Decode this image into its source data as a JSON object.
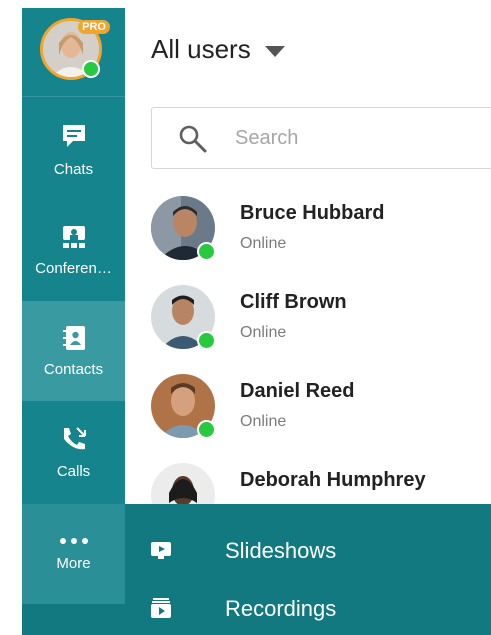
{
  "user": {
    "pro_badge": "PRO"
  },
  "sidebar": {
    "items": [
      {
        "label": "Chats",
        "icon": "chat-icon"
      },
      {
        "label": "Conferen…",
        "icon": "conference-icon"
      },
      {
        "label": "Contacts",
        "icon": "contacts-icon",
        "active": true
      },
      {
        "label": "Calls",
        "icon": "calls-icon"
      }
    ],
    "more_label": "More"
  },
  "header": {
    "title": "All users"
  },
  "search": {
    "placeholder": "Search"
  },
  "contacts": [
    {
      "name": "Bruce Hubbard",
      "status": "Online"
    },
    {
      "name": "Cliff Brown",
      "status": "Online"
    },
    {
      "name": "Daniel Reed",
      "status": "Online"
    },
    {
      "name": "Deborah Humphrey",
      "status": ""
    }
  ],
  "more_menu": [
    {
      "label": "Slideshows",
      "icon": "slideshow-icon"
    },
    {
      "label": "Recordings",
      "icon": "recordings-icon"
    }
  ],
  "colors": {
    "sidebar": "#16848d",
    "sidebar_active": "#3a9aa2",
    "more_panel": "#11797f",
    "online": "#27c93f",
    "pro": "#f2a52c"
  }
}
